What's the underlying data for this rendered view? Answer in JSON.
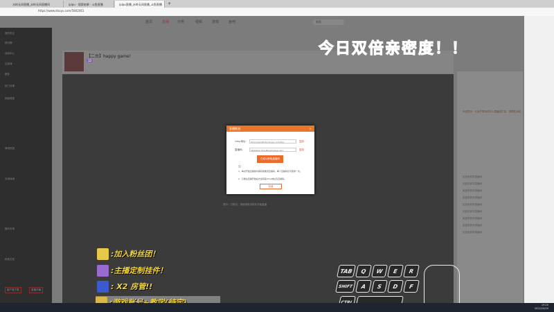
{
  "browser": {
    "tabs": [
      "水岭无间直播_水岭无间直播间",
      "ipipu - 搜索结果 - 斗鱼直播",
      "ipipu直播_水岭无间直播_斗鱼直播"
    ],
    "url": "https://www.douyu.com/5842461",
    "new_tab": "+"
  },
  "nav": {
    "items": [
      "首页",
      "直播",
      "分类",
      "视频",
      "游戏",
      "鱼吧"
    ],
    "search_placeholder": "搜索"
  },
  "sidebar": {
    "top": [
      "我的关注",
      "排行榜",
      "活动中心",
      "云游戏",
      "更多"
    ],
    "sections": [
      "热门分类",
      "网游竞技",
      "单机热游",
      "手游休闲",
      "娱乐天地",
      "科技文化"
    ],
    "buttons": [
      "客户端下载",
      "直播开播"
    ]
  },
  "stream": {
    "title": "【二台】happy game!",
    "level_badge": "12"
  },
  "promo": "今日双倍亲密度！！",
  "modal": {
    "title": "直播推流",
    "rtmp_label": "rtmp地址:",
    "rtmp_value": "rtmp://sendtc3a.douyu.com/live",
    "code_label": "直播码:",
    "code_value": "5842461rYb5vBtGQ?wsSecret=",
    "copy": "复制",
    "button": "已成功获取直播码",
    "notes_title": "注:",
    "note1": "1、每次开始直播前均需获取推流直播码，每个直播码仅可使用一次。",
    "note2": "2、只能在直播开始后才会获取rtmp地址及直播码。",
    "ok": "知道"
  },
  "video_hint": "提示：已推流，请使用推流软件开始直播",
  "captions": [
    ":加入粉丝团！",
    ":主播定制挂件！",
    ": X2 房管!!",
    ":游戏账号+教学(待定)"
  ],
  "keys": [
    "TAB",
    "Q",
    "W",
    "E",
    "R",
    "SHIFT",
    "A",
    "S",
    "D",
    "F",
    "CTRL"
  ],
  "chat": {
    "welcome": "欢迎来到本直播间",
    "entries": [
      "欢迎来到本直播间",
      "欢迎来到本直播间",
      "欢迎来到本直播间",
      "欢迎来到本直播间",
      "欢迎来到本直播间",
      "欢迎来到本直播间",
      "欢迎来到本直播间",
      "欢迎来到本直播间",
      "欢迎来到本直播间"
    ],
    "notice": "系统提示：斗鱼严禁未成年人直播或打赏，请理性消费。"
  },
  "clock": {
    "time": "19:20",
    "date": "2022/10/20"
  }
}
